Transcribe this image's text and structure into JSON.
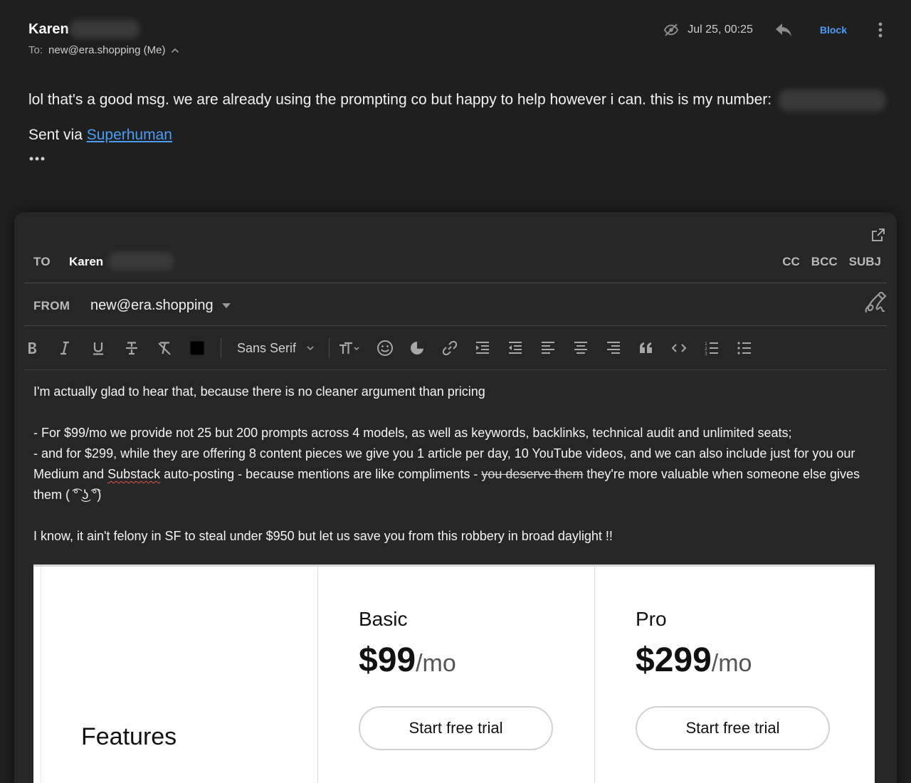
{
  "message": {
    "sender_first_name": "Karen",
    "to_label": "To:",
    "to_value": "new@era.shopping (Me)",
    "date": "Jul 25, 00:25",
    "block_label": "Block",
    "body_text": "lol that's a good msg. we are already using the prompting co but happy to help however i can. this is my number:",
    "sent_via_prefix": "Sent via ",
    "sent_via_link": "Superhuman",
    "icons": [
      "eye-off-icon",
      "reply-icon",
      "more-vertical-icon",
      "chevron-up-icon",
      "ellipsis-icon"
    ]
  },
  "compose": {
    "to_label": "TO",
    "to_name": "Karen",
    "cc_label": "CC",
    "bcc_label": "BCC",
    "subj_label": "SUBJ",
    "from_label": "FROM",
    "from_value": "new@era.shopping",
    "font_family_label": "Sans Serif",
    "text_color": "#000000",
    "body": {
      "p1": "I'm actually glad to hear that, because there is no cleaner argument than pricing",
      "p2": "- For $99/mo we provide not 25 but 200 prompts across 4 models, as well as keywords, backlinks, technical audit and unlimited seats;",
      "p3_a": "- and for $299, while they are offering 8 content pieces we give you 1 article per day, 10 YouTube videos, and we can also include just for you our Medium and ",
      "p3_spell": "Substack",
      "p3_b": " auto-posting - because mentions are like compliments - ",
      "p3_strike": "you deserve them",
      "p3_c": " they're more valuable when someone else gives them ( ͡° ͜ʖ ͡°)",
      "p4": "I know, it ain't felony in SF to steal under $950 but let us save you from this robbery in broad daylight !!"
    }
  },
  "pricing": {
    "features_title": "Features",
    "plans": [
      {
        "name": "Basic",
        "price": "$99",
        "period": "/mo",
        "cta": "Start free trial"
      },
      {
        "name": "Pro",
        "price": "$299",
        "period": "/mo",
        "cta": "Start free trial"
      }
    ]
  },
  "colors": {
    "background": "#1f1f1f",
    "compose_background": "#262626",
    "link": "#4b9cf5"
  }
}
